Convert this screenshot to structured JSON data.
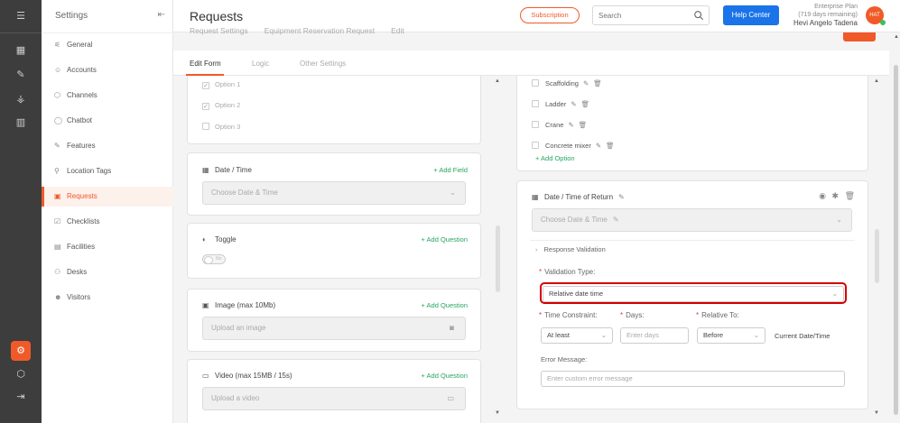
{
  "rail": {
    "icons": [
      "menu-icon",
      "dashboard-icon",
      "broom-icon",
      "org-chart-icon",
      "analytics-icon",
      "gear-icon",
      "cube-icon",
      "exit-icon"
    ]
  },
  "sidebar": {
    "title": "Settings",
    "items": [
      {
        "label": "General",
        "icon": "sliders-icon",
        "glyph": "⚟"
      },
      {
        "label": "Accounts",
        "icon": "users-icon",
        "glyph": "☺"
      },
      {
        "label": "Channels",
        "icon": "cube-icon",
        "glyph": "⬡"
      },
      {
        "label": "Chatbot",
        "icon": "chat-icon",
        "glyph": "◯"
      },
      {
        "label": "Features",
        "icon": "broom-icon",
        "glyph": "✎"
      },
      {
        "label": "Location Tags",
        "icon": "pin-icon",
        "glyph": "⚲"
      },
      {
        "label": "Requests",
        "icon": "request-icon",
        "glyph": "▣",
        "active": true
      },
      {
        "label": "Checklists",
        "icon": "checklist-icon",
        "glyph": "☑"
      },
      {
        "label": "Facilities",
        "icon": "building-icon",
        "glyph": "▤"
      },
      {
        "label": "Desks",
        "icon": "desk-icon",
        "glyph": "⚇"
      },
      {
        "label": "Visitors",
        "icon": "visitors-icon",
        "glyph": "☻"
      }
    ]
  },
  "header": {
    "title": "Requests",
    "subscription_label": "Subscription",
    "search_placeholder": "Search",
    "help_label": "Help Center",
    "plan": "Enterprise Plan",
    "days_remaining": "(719 days remaining)",
    "user_name": "Hevi Angelo Tadena",
    "avatar_initials": "HAT"
  },
  "breadcrumb": [
    "Request Settings",
    "Equipment Reservation Request",
    "Edit"
  ],
  "tabs": [
    {
      "label": "Edit Form",
      "active": true
    },
    {
      "label": "Logic"
    },
    {
      "label": "Other Settings"
    }
  ],
  "palette": {
    "options": [
      "Option 1",
      "Option 2",
      "Option 3"
    ],
    "datetime": {
      "title": "Date / Time",
      "add": "+ Add Field",
      "placeholder": "Choose Date & Time"
    },
    "toggle": {
      "title": "Toggle",
      "add": "+ Add Question",
      "state": "No"
    },
    "image": {
      "title": "Image (max 10Mb)",
      "add": "+ Add Question",
      "placeholder": "Upload an image"
    },
    "video": {
      "title": "Video (max 15MB / 15s)",
      "add": "+ Add Question",
      "placeholder": "Upload a video"
    }
  },
  "form": {
    "equipment": [
      "Scaffolding",
      "Ladder",
      "Crane",
      "Concrete mixer"
    ],
    "add_option": "+ Add Option",
    "return_field": {
      "title": "Date / Time of Return",
      "placeholder": "Choose Date & Time",
      "validation_section": "Response Validation",
      "validation_type_label": "Validation Type:",
      "validation_type_value": "Relative date time",
      "time_constraint_label": "Time Constraint:",
      "time_constraint_value": "At least",
      "days_label": "Days:",
      "days_placeholder": "Enter days",
      "relative_to_label": "Relative To:",
      "relative_to_value": "Before",
      "relative_target": "Current Date/Time",
      "error_label": "Error Message:",
      "error_placeholder": "Enter custom error message"
    }
  }
}
